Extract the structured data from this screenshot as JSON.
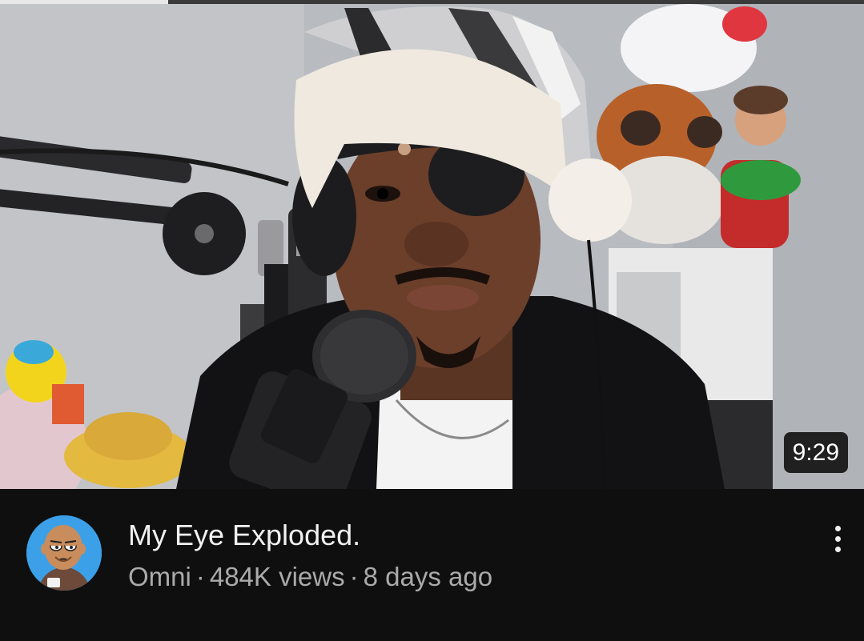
{
  "video": {
    "title": "My Eye Exploded.",
    "duration": "9:29",
    "watch_progress_fraction": 0.195,
    "thumbnail": "man-with-eyepatch-and-santa-hat-at-microphone"
  },
  "channel": {
    "name": "Omni",
    "avatar": "cartoon-bald-man-avatar"
  },
  "stats": {
    "views": "484K views",
    "age": "8 days ago",
    "separator": "·"
  },
  "menu": {
    "icon": "more-vertical-icon"
  }
}
